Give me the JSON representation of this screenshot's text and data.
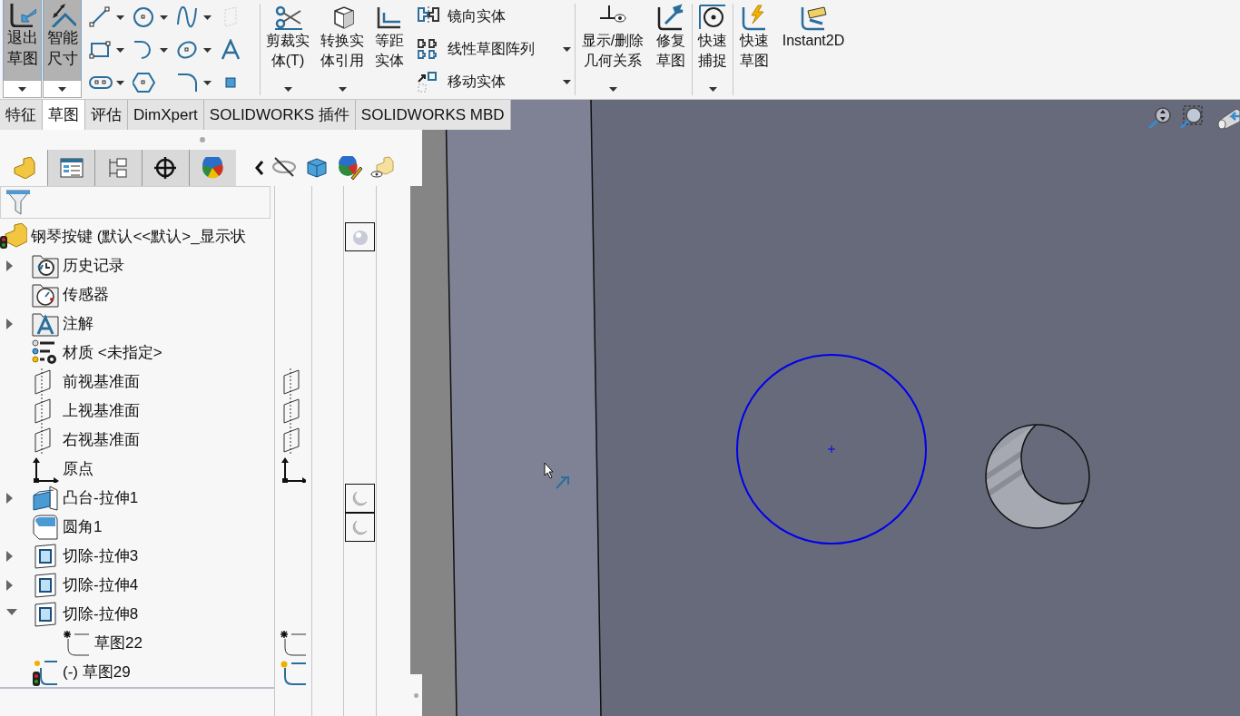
{
  "ribbon": {
    "mode_buttons": [
      {
        "kind": "exit",
        "lines": [
          "退出",
          "草图"
        ],
        "selected": true
      },
      {
        "kind": "dimension",
        "lines": [
          "智能",
          "尺寸"
        ],
        "selected": true
      }
    ],
    "commands": [
      {
        "kind": "trim",
        "lines": [
          "剪裁实",
          "体(T)"
        ],
        "dropdown": true
      },
      {
        "kind": "convert",
        "lines": [
          "转换实",
          "体引用"
        ],
        "dropdown": true
      },
      {
        "kind": "offset",
        "lines": [
          "等距",
          "实体"
        ],
        "dropdown": false
      }
    ],
    "command_list": [
      {
        "kind": "mirror",
        "label": "镜向实体",
        "dropdown": false
      },
      {
        "kind": "pattern",
        "label": "线性草图阵列",
        "dropdown": true
      },
      {
        "kind": "move",
        "label": "移动实体",
        "dropdown": true
      }
    ],
    "relation_commands": [
      {
        "kind": "relations",
        "lines": [
          "显示/删除",
          "几何关系"
        ],
        "dropdown": true
      },
      {
        "kind": "repair",
        "lines": [
          "修复",
          "草图"
        ],
        "dropdown": false
      }
    ],
    "snap_commands": [
      {
        "kind": "snap",
        "lines": [
          "快速",
          "捕捉"
        ],
        "dropdown": true
      }
    ],
    "end_commands": [
      {
        "kind": "quick",
        "lines": [
          "快速",
          "草图"
        ],
        "dropdown": false
      },
      {
        "kind": "instant2d",
        "lines": [
          "Instant2D"
        ],
        "dropdown": false
      }
    ]
  },
  "panel_tabs": [
    {
      "selected": true
    },
    {
      "selected": false
    },
    {
      "selected": false
    },
    {
      "selected": false
    },
    {
      "selected": false
    }
  ],
  "tabs": [
    {
      "label": "特征",
      "selected": false
    },
    {
      "label": "草图",
      "selected": true
    },
    {
      "label": "评估",
      "selected": false
    },
    {
      "label": "DimXpert",
      "selected": false
    },
    {
      "label": "SOLIDWORKS 插件",
      "selected": false
    },
    {
      "label": "SOLIDWORKS MBD",
      "selected": false
    }
  ],
  "tree": [
    {
      "kind": "part",
      "label": "钢琴按键 (默认<<默认>_显示状",
      "appearance": true,
      "children": [
        {
          "kind": "history",
          "label": "历史记录",
          "expanded": false,
          "appearance": false
        },
        {
          "kind": "sensor",
          "label": "传感器",
          "appearance": false
        },
        {
          "kind": "annotation",
          "label": "注解",
          "expanded": false,
          "appearance": false
        },
        {
          "kind": "material",
          "label": "材质 <未指定>",
          "appearance": false
        },
        {
          "kind": "plane",
          "label": "前视基准面",
          "appearance": false
        },
        {
          "kind": "plane",
          "label": "上视基准面",
          "appearance": false
        },
        {
          "kind": "plane",
          "label": "右视基准面",
          "appearance": false
        },
        {
          "kind": "origin",
          "label": "原点",
          "appearance": false
        },
        {
          "kind": "boss",
          "label": "凸台-拉伸1",
          "expanded": false,
          "appearance": true
        },
        {
          "kind": "fillet",
          "label": "圆角1",
          "appearance": true
        },
        {
          "kind": "cut",
          "label": "切除-拉伸3",
          "expanded": false,
          "appearance": false
        },
        {
          "kind": "cut",
          "label": "切除-拉伸4",
          "expanded": false,
          "appearance": false
        },
        {
          "kind": "cut",
          "label": "切除-拉伸8",
          "expanded": true,
          "appearance": false,
          "children": [
            {
              "kind": "sketch",
              "label": "草图22",
              "appearance": false
            }
          ]
        },
        {
          "kind": "active_sketch",
          "label": "(-) 草图29",
          "appearance": false
        }
      ]
    }
  ]
}
